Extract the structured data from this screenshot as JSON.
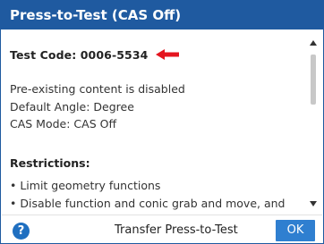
{
  "dialog": {
    "title": "Press-to-Test (CAS Off)",
    "test_code": "Test Code: 0006-5534",
    "status_lines": [
      "Pre-existing content is disabled",
      "Default Angle: Degree",
      "CAS Mode: CAS Off"
    ],
    "restrictions_heading": "Restrictions:",
    "restrictions": [
      "• Limit geometry functions",
      "• Disable function and conic grab and move, and"
    ]
  },
  "footer": {
    "help_label": "?",
    "transfer_label": "Transfer Press-to-Test",
    "ok_label": "OK"
  },
  "icons": {
    "pointer": "red-arrow-icon",
    "help": "help-icon",
    "scroll_up": "scroll-up-icon",
    "scroll_down": "scroll-down-icon"
  },
  "colors": {
    "title_bar": "#1f5aa0",
    "ok_button": "#2f7fd0",
    "help_button": "#1f6fc0",
    "arrow": "#e4151f"
  }
}
